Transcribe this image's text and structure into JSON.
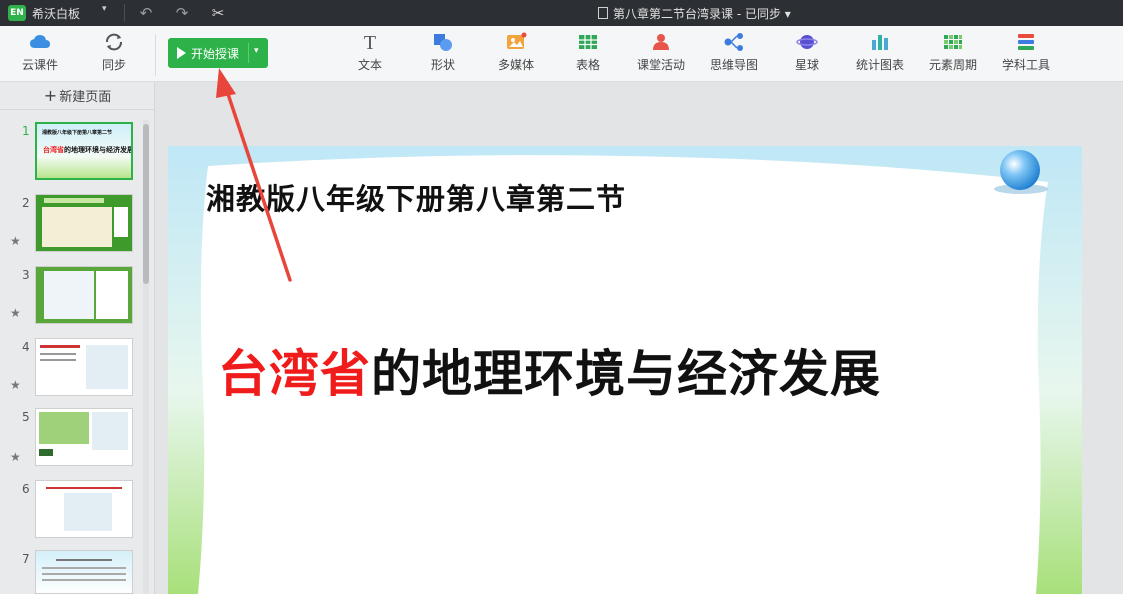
{
  "titlebar": {
    "logo": "EN",
    "app_name": "希沃白板",
    "menu_caret": "▾",
    "doc_title": "第八章第二节台湾录课 - 已同步 ▾"
  },
  "toolbar": {
    "cloud_label": "云课件",
    "sync_label": "同步",
    "start_label": "开始授课",
    "start_caret": "▾",
    "tools": [
      "文本",
      "形状",
      "多媒体",
      "表格",
      "课堂活动",
      "思维导图",
      "星球",
      "统计图表",
      "元素周期",
      "学科工具"
    ]
  },
  "sidebar": {
    "new_page": "新建页面",
    "pages": [
      "1",
      "2",
      "3",
      "4",
      "5",
      "6",
      "7"
    ],
    "thumb1_line1": "湘教版八年级下册第八章第二节",
    "thumb1_red": "台湾省",
    "thumb1_black": "的地理环境与经济发展"
  },
  "slide": {
    "subtitle": "湘教版八年级下册第八章第二节",
    "title_red": "台湾省",
    "title_black": "的地理环境与经济发展"
  },
  "colors": {
    "accent": "#2db24a",
    "title_red": "#f01c1c",
    "arrow": "#e8463c"
  }
}
